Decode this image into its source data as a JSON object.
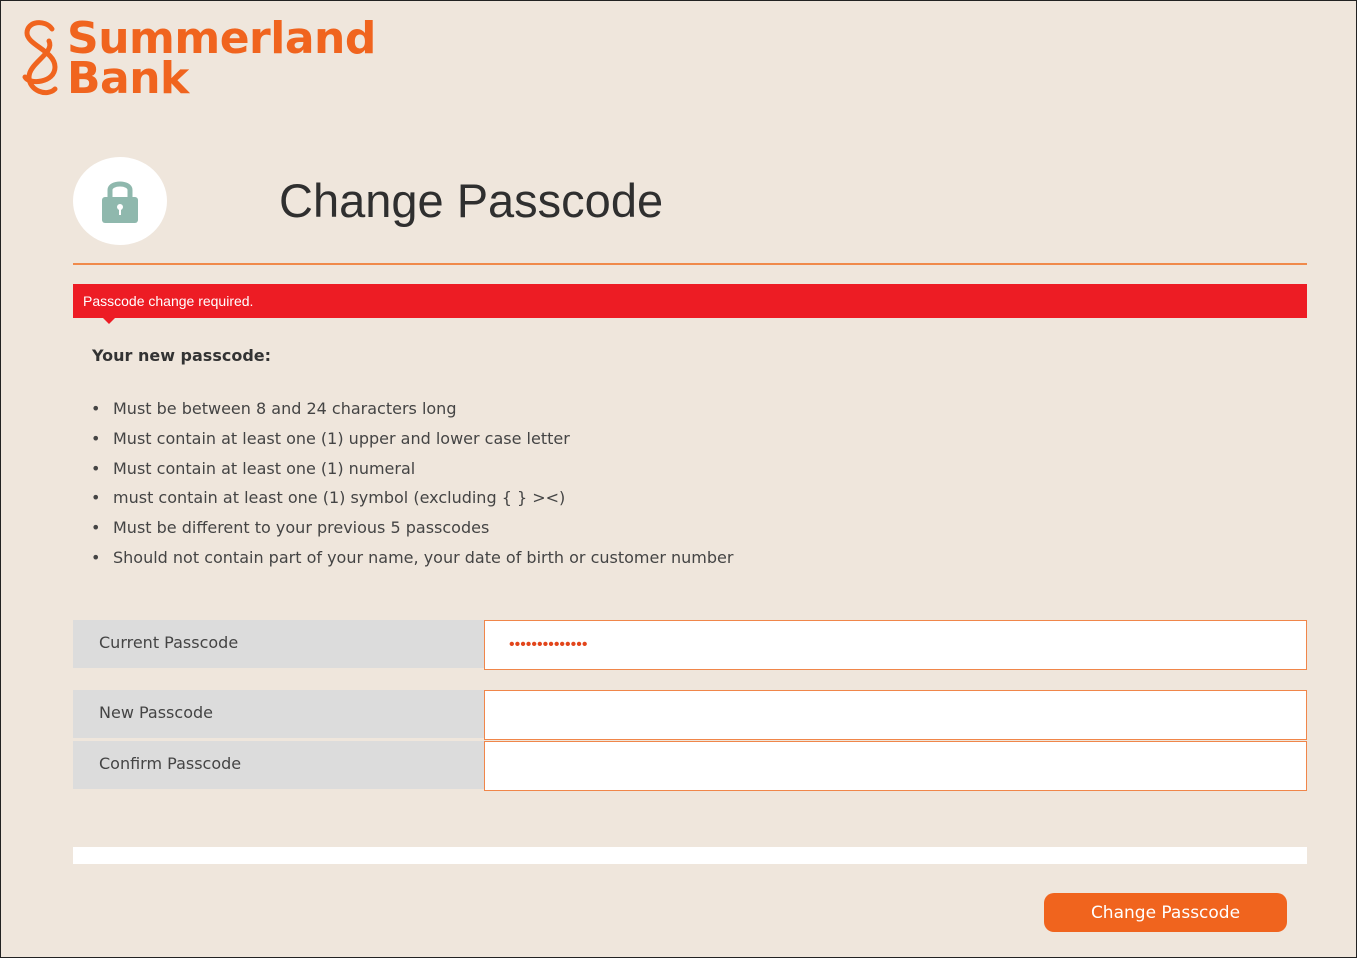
{
  "brand": {
    "name_line1": "Summerland",
    "name_line2": "Bank",
    "color": "#f0641e",
    "icon": "summerland-s-logo-icon"
  },
  "header": {
    "icon": "padlock-icon",
    "title": "Change Passcode"
  },
  "alert": {
    "message": "Passcode change required.",
    "color": "#ed1c24"
  },
  "requirements": {
    "heading": "Your new passcode:",
    "items": [
      "Must be between 8 and 24 characters long",
      "Must contain at least one (1) upper and lower case letter",
      "Must contain at least one (1) numeral",
      "must contain at least one (1) symbol (excluding { } ><)",
      "Must be different to your previous 5 passcodes",
      "Should not contain part of your name, your date of birth or customer number"
    ]
  },
  "form": {
    "current": {
      "label": "Current Passcode",
      "value": "••••••••••••••"
    },
    "new": {
      "label": "New Passcode",
      "value": ""
    },
    "confirm": {
      "label": "Confirm Passcode",
      "value": ""
    },
    "submit_label": "Change Passcode",
    "accent": "#f0864a"
  }
}
